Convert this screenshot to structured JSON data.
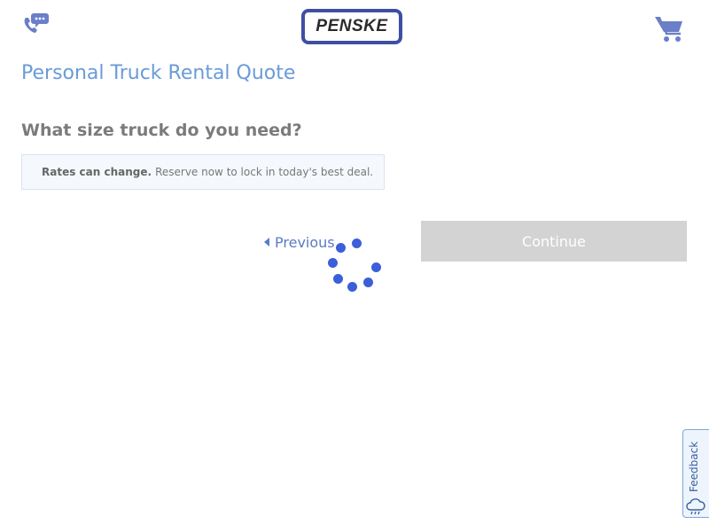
{
  "header": {
    "logo_text": "PENSKE",
    "phone_icon": "phone-chat-icon",
    "cart_icon": "shopping-cart-icon"
  },
  "main": {
    "page_title": "Personal Truck Rental Quote",
    "question": "What size truck do you need?",
    "notice": {
      "strong": "Rates can change.",
      "text": "Reserve now to lock in today's best deal."
    },
    "previous_label": "Previous",
    "continue_label": "Continue",
    "loading_icon": "loading-spinner-icon"
  },
  "feedback": {
    "label": "Feedback",
    "icon": "feedback-cloud-icon"
  },
  "colors": {
    "brand_blue": "#3e4fa3",
    "title_blue": "#6a9bd8",
    "link_blue": "#5a7bc4",
    "spinner_blue": "#3b5fd9",
    "disabled_button": "#d3d3d3"
  }
}
